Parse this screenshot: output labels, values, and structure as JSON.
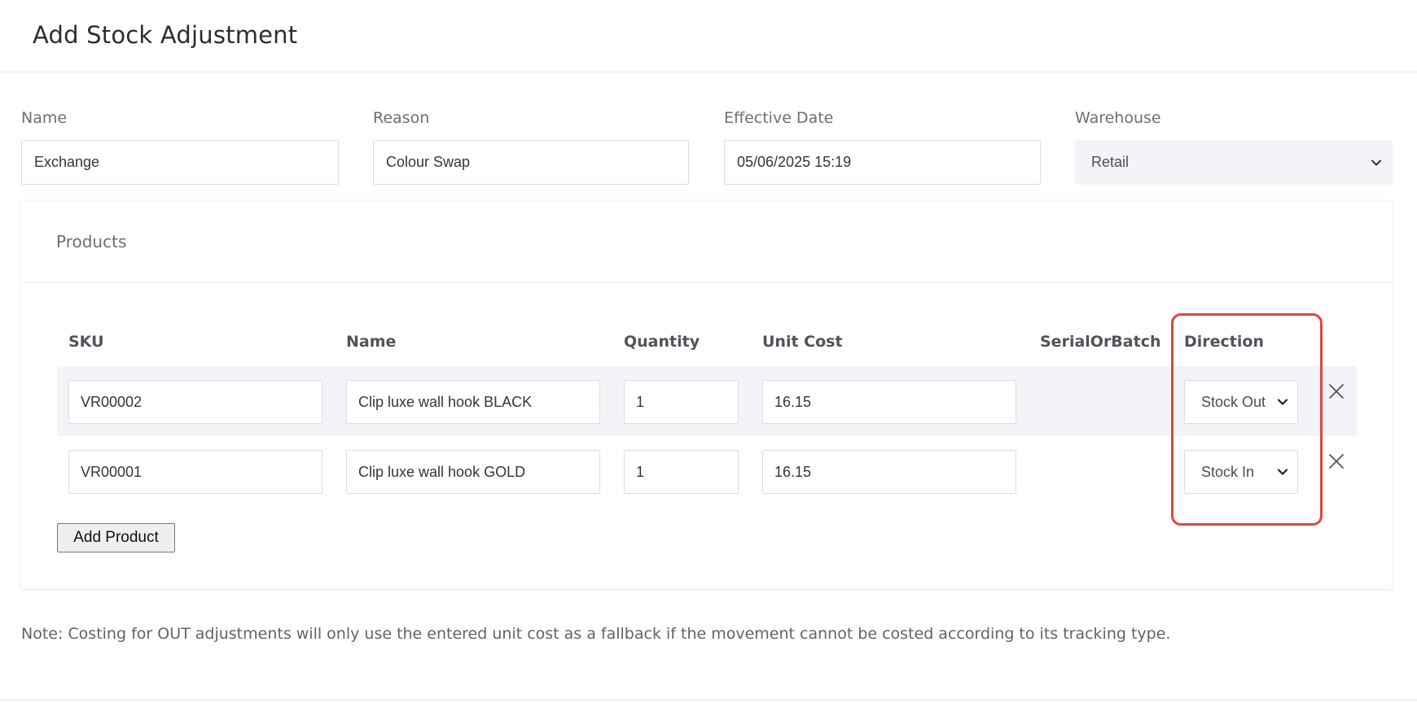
{
  "page": {
    "title": "Add Stock Adjustment"
  },
  "form": {
    "name": {
      "label": "Name",
      "value": "Exchange"
    },
    "reason": {
      "label": "Reason",
      "value": "Colour Swap"
    },
    "effective_date": {
      "label": "Effective Date",
      "value": "05/06/2025 15:19"
    },
    "warehouse": {
      "label": "Warehouse",
      "value": "Retail"
    }
  },
  "products": {
    "title": "Products",
    "columns": {
      "sku": "SKU",
      "name": "Name",
      "quantity": "Quantity",
      "unit_cost": "Unit Cost",
      "serial_or_batch": "SerialOrBatch",
      "direction": "Direction"
    },
    "rows": [
      {
        "sku": "VR00002",
        "name": "Clip luxe wall hook BLACK",
        "quantity": "1",
        "unit_cost": "16.15",
        "direction": "Stock Out"
      },
      {
        "sku": "VR00001",
        "name": "Clip luxe wall hook GOLD",
        "quantity": "1",
        "unit_cost": "16.15",
        "direction": "Stock In"
      }
    ],
    "add_button": "Add Product"
  },
  "note": "Note: Costing for OUT adjustments will only use the entered unit cost as a fallback if the movement cannot be costed according to its tracking type.",
  "icons": {
    "remove": "close-icon",
    "dropdown": "chevron-down-icon"
  },
  "colors": {
    "highlight": "#d9493e",
    "row_stripe": "#f3f4f7",
    "warehouse_bg": "#f3f4f7",
    "border": "#dcdee3"
  }
}
